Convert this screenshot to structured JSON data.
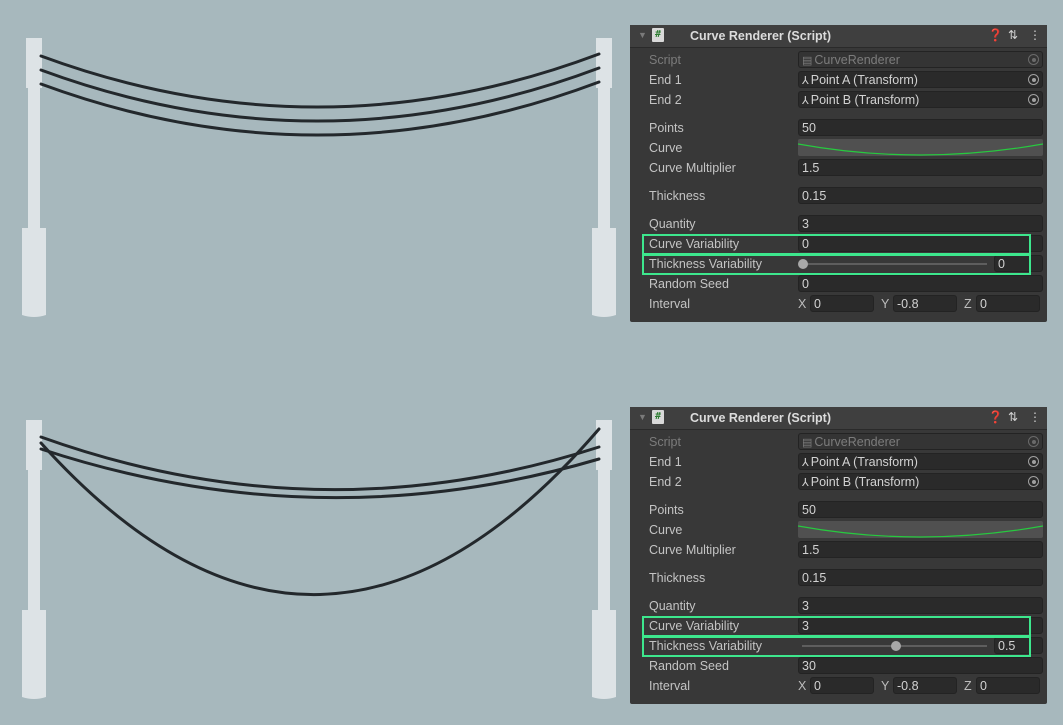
{
  "panels": [
    {
      "title": "Curve Renderer (Script)",
      "script": {
        "label": "Script",
        "value": "CurveRenderer"
      },
      "end1": {
        "label": "End 1",
        "value": "Point A (Transform)"
      },
      "end2": {
        "label": "End 2",
        "value": "Point B (Transform)"
      },
      "points": {
        "label": "Points",
        "value": "50"
      },
      "curve": {
        "label": "Curve"
      },
      "curve_multiplier": {
        "label": "Curve Multiplier",
        "value": "1.5"
      },
      "thickness": {
        "label": "Thickness",
        "value": "0.15"
      },
      "quantity": {
        "label": "Quantity",
        "value": "3"
      },
      "curve_variability": {
        "label": "Curve Variability",
        "value": "0"
      },
      "thickness_variability": {
        "label": "Thickness Variability",
        "value": "0",
        "level": 0
      },
      "random_seed": {
        "label": "Random Seed",
        "value": "0"
      },
      "interval": {
        "label": "Interval",
        "x_label": "X",
        "x": "0",
        "y_label": "Y",
        "y": "-0.8",
        "z_label": "Z",
        "z": "0"
      }
    },
    {
      "title": "Curve Renderer (Script)",
      "script": {
        "label": "Script",
        "value": "CurveRenderer"
      },
      "end1": {
        "label": "End 1",
        "value": "Point A (Transform)"
      },
      "end2": {
        "label": "End 2",
        "value": "Point B (Transform)"
      },
      "points": {
        "label": "Points",
        "value": "50"
      },
      "curve": {
        "label": "Curve"
      },
      "curve_multiplier": {
        "label": "Curve Multiplier",
        "value": "1.5"
      },
      "thickness": {
        "label": "Thickness",
        "value": "0.15"
      },
      "quantity": {
        "label": "Quantity",
        "value": "3"
      },
      "curve_variability": {
        "label": "Curve Variability",
        "value": "3"
      },
      "thickness_variability": {
        "label": "Thickness Variability",
        "value": "0.5",
        "level": 0.5
      },
      "random_seed": {
        "label": "Random Seed",
        "value": "30"
      },
      "interval": {
        "label": "Interval",
        "x_label": "X",
        "x": "0",
        "y_label": "Y",
        "y": "-0.8",
        "z_label": "Z",
        "z": "0"
      }
    }
  ],
  "icons": {
    "header": [
      "foldout-arrow-icon",
      "csharp-script-icon",
      "help-icon",
      "preset-sliders-icon",
      "kebab-menu-icon"
    ],
    "fields": [
      "script-asset-icon",
      "transform-icon",
      "object-picker-icon"
    ]
  },
  "colors": {
    "background": "#a7b8bd",
    "pole": "#dde3e6",
    "wire": "#23282c",
    "inspector": "#383838",
    "field": "#2a2a2a",
    "curve_line": "#27c93f",
    "highlight": "#3de78d"
  }
}
